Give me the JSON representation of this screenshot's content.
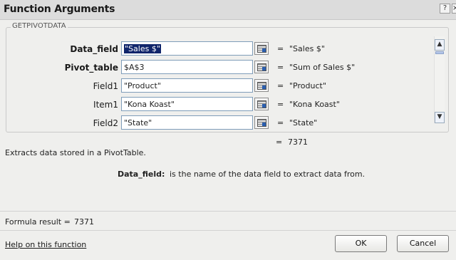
{
  "window": {
    "title": "Function Arguments",
    "help_glyph": "?",
    "close_glyph": "×"
  },
  "function_group": {
    "name": "GETPIVOTDATA",
    "rows": [
      {
        "label": "Data_field",
        "bold": true,
        "input": "\"Sales $\"",
        "selected": true,
        "equals": "=",
        "value": "\"Sales $\""
      },
      {
        "label": "Pivot_table",
        "bold": true,
        "input": "$A$3",
        "selected": false,
        "equals": "=",
        "value": "\"Sum of Sales $\""
      },
      {
        "label": "Field1",
        "bold": false,
        "input": "\"Product\"",
        "selected": false,
        "equals": "=",
        "value": "\"Product\""
      },
      {
        "label": "Item1",
        "bold": false,
        "input": "\"Kona Koast\"",
        "selected": false,
        "equals": "=",
        "value": "\"Kona Koast\""
      },
      {
        "label": "Field2",
        "bold": false,
        "input": "\"State\"",
        "selected": false,
        "equals": "=",
        "value": "\"State\""
      }
    ]
  },
  "result": {
    "equals": "=",
    "value": "7371"
  },
  "description": "Extracts data stored in a PivotTable.",
  "arg_help": {
    "name": "Data_field:",
    "text": "is the name of the data field to extract data from."
  },
  "formula_result": {
    "label": "Formula result =",
    "value": "7371"
  },
  "footer": {
    "help_link": "Help on this function",
    "ok": "OK",
    "cancel": "Cancel"
  },
  "colors": {
    "title_bar": "#dcdcdc",
    "dialog_bg": "#efefed",
    "selection": "#10256b",
    "input_border": "#7f9db9"
  }
}
